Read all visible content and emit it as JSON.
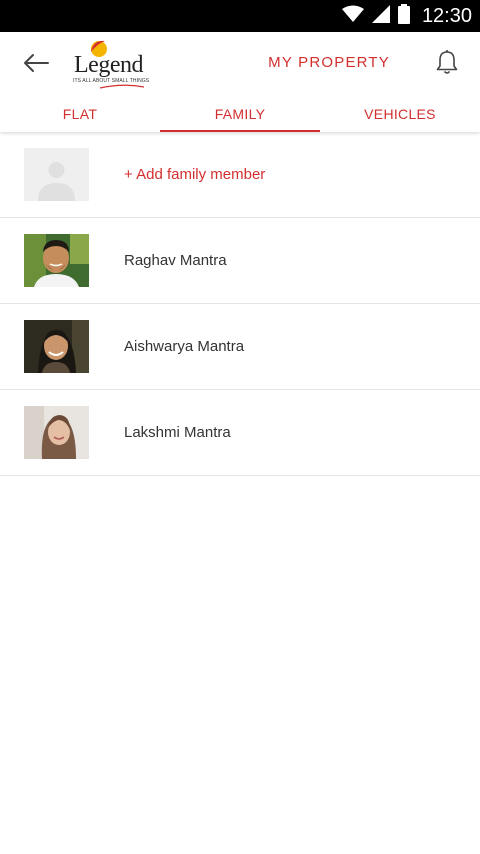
{
  "status_bar": {
    "time": "12:30"
  },
  "header": {
    "logo_text": "Legend",
    "logo_tagline": "ITS ALL ABOUT SMALL THINGS",
    "title": "MY PROPERTY"
  },
  "tabs": [
    {
      "label": "FLAT",
      "active": false
    },
    {
      "label": "FAMILY",
      "active": true
    },
    {
      "label": "VEHICLES",
      "active": false
    }
  ],
  "family": {
    "add_label": "+ Add family member",
    "members": [
      {
        "name": "Raghav Mantra"
      },
      {
        "name": "Aishwarya Mantra"
      },
      {
        "name": "Lakshmi Mantra"
      }
    ]
  },
  "colors": {
    "accent": "#d32f2f",
    "status_bar": "#000000"
  }
}
